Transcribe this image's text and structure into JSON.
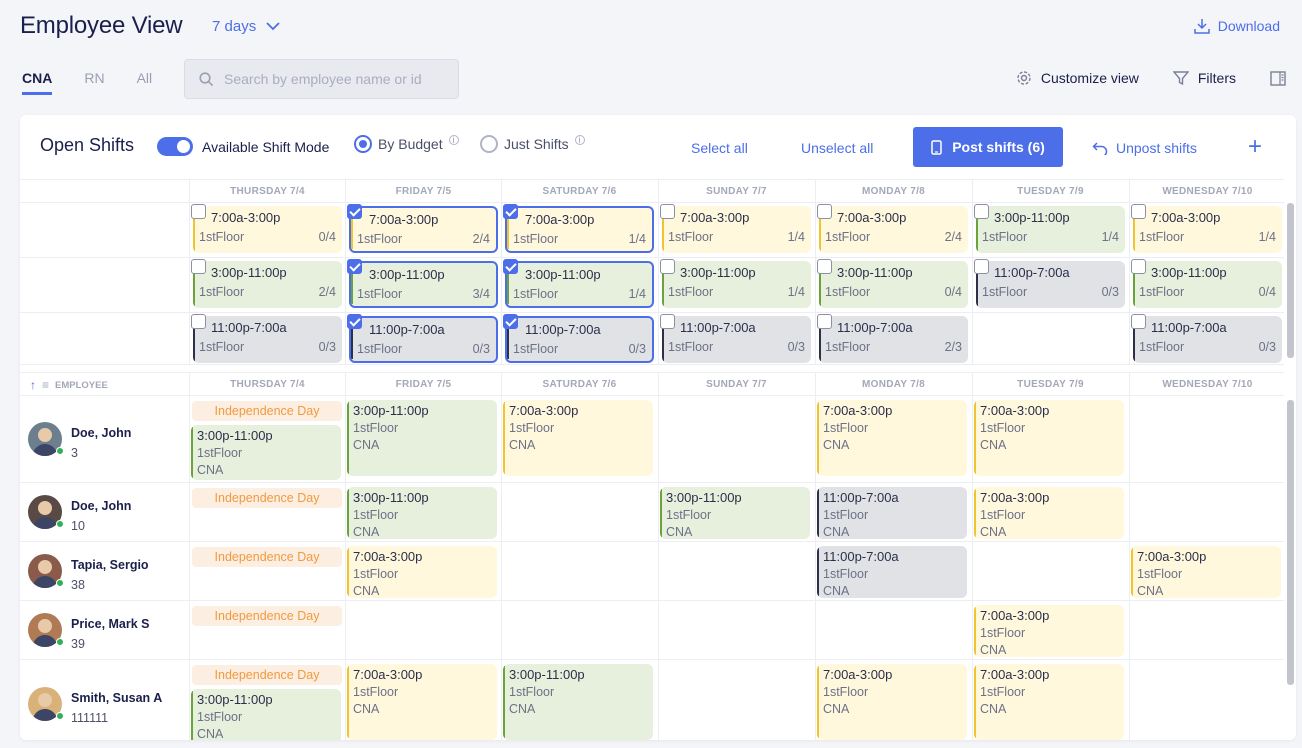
{
  "header": {
    "title": "Employee View",
    "range": "7 days",
    "download": "Download"
  },
  "tabs": [
    "CNA",
    "RN",
    "All"
  ],
  "search": {
    "placeholder": "Search by employee name or id",
    "value": ""
  },
  "tools": {
    "customize": "Customize view",
    "filters": "Filters"
  },
  "controls": {
    "open_shifts": "Open Shifts",
    "available_mode": "Available Shift Mode",
    "by_budget": "By Budget",
    "just_shifts": "Just Shifts",
    "select_all": "Select all",
    "unselect_all": "Unselect all",
    "post": "Post shifts (6)",
    "unpost": "Unpost shifts"
  },
  "days": [
    "THURSDAY 7/4",
    "FRIDAY 7/5",
    "SATURDAY 7/6",
    "SUNDAY 7/7",
    "MONDAY 7/8",
    "TUESDAY 7/9",
    "WEDNESDAY 7/10"
  ],
  "employee_header": "EMPLOYEE",
  "holiday": "Independence Day",
  "open_shifts": [
    [
      {
        "time": "7:00a-3:00p",
        "loc": "1stFloor",
        "count": "0/4",
        "color": "y",
        "checked": false
      },
      {
        "time": "7:00a-3:00p",
        "loc": "1stFloor",
        "count": "2/4",
        "color": "y",
        "checked": true
      },
      {
        "time": "7:00a-3:00p",
        "loc": "1stFloor",
        "count": "1/4",
        "color": "y",
        "checked": true
      },
      {
        "time": "7:00a-3:00p",
        "loc": "1stFloor",
        "count": "1/4",
        "color": "y",
        "checked": false
      },
      {
        "time": "7:00a-3:00p",
        "loc": "1stFloor",
        "count": "2/4",
        "color": "y",
        "checked": false
      },
      {
        "time": "3:00p-11:00p",
        "loc": "1stFloor",
        "count": "1/4",
        "color": "g",
        "checked": false
      },
      {
        "time": "7:00a-3:00p",
        "loc": "1stFloor",
        "count": "1/4",
        "color": "y",
        "checked": false
      }
    ],
    [
      {
        "time": "3:00p-11:00p",
        "loc": "1stFloor",
        "count": "2/4",
        "color": "g",
        "checked": false
      },
      {
        "time": "3:00p-11:00p",
        "loc": "1stFloor",
        "count": "3/4",
        "color": "g",
        "checked": true
      },
      {
        "time": "3:00p-11:00p",
        "loc": "1stFloor",
        "count": "1/4",
        "color": "g",
        "checked": true
      },
      {
        "time": "3:00p-11:00p",
        "loc": "1stFloor",
        "count": "1/4",
        "color": "g",
        "checked": false
      },
      {
        "time": "3:00p-11:00p",
        "loc": "1stFloor",
        "count": "0/4",
        "color": "g",
        "checked": false
      },
      {
        "time": "11:00p-7:00a",
        "loc": "1stFloor",
        "count": "0/3",
        "color": "d",
        "checked": false
      },
      {
        "time": "3:00p-11:00p",
        "loc": "1stFloor",
        "count": "0/4",
        "color": "g",
        "checked": false
      }
    ],
    [
      {
        "time": "11:00p-7:00a",
        "loc": "1stFloor",
        "count": "0/3",
        "color": "d",
        "checked": false
      },
      {
        "time": "11:00p-7:00a",
        "loc": "1stFloor",
        "count": "0/3",
        "color": "d",
        "checked": true
      },
      {
        "time": "11:00p-7:00a",
        "loc": "1stFloor",
        "count": "0/3",
        "color": "d",
        "checked": true
      },
      {
        "time": "11:00p-7:00a",
        "loc": "1stFloor",
        "count": "0/3",
        "color": "d",
        "checked": false
      },
      {
        "time": "11:00p-7:00a",
        "loc": "1stFloor",
        "count": "2/3",
        "color": "d",
        "checked": false
      },
      null,
      {
        "time": "11:00p-7:00a",
        "loc": "1stFloor",
        "count": "0/3",
        "color": "d",
        "checked": false
      }
    ]
  ],
  "employees": [
    {
      "name": "Doe, John",
      "id": "3",
      "holiday": true,
      "shifts": [
        {
          "day": 0,
          "time": "3:00p-11:00p",
          "loc": "1stFloor",
          "role": "CNA",
          "color": "g"
        },
        {
          "day": 1,
          "time": "3:00p-11:00p",
          "loc": "1stFloor",
          "role": "CNA",
          "color": "g"
        },
        {
          "day": 2,
          "time": "7:00a-3:00p",
          "loc": "1stFloor",
          "role": "CNA",
          "color": "y"
        },
        {
          "day": 4,
          "time": "7:00a-3:00p",
          "loc": "1stFloor",
          "role": "CNA",
          "color": "y"
        },
        {
          "day": 5,
          "time": "7:00a-3:00p",
          "loc": "1stFloor",
          "role": "CNA",
          "color": "y"
        }
      ]
    },
    {
      "name": "Doe, John",
      "id": "10",
      "holiday": true,
      "shifts": [
        {
          "day": 1,
          "time": "3:00p-11:00p",
          "loc": "1stFloor",
          "role": "CNA",
          "color": "g"
        },
        {
          "day": 3,
          "time": "3:00p-11:00p",
          "loc": "1stFloor",
          "role": "CNA",
          "color": "g"
        },
        {
          "day": 4,
          "time": "11:00p-7:00a",
          "loc": "1stFloor",
          "role": "CNA",
          "color": "d"
        },
        {
          "day": 5,
          "time": "7:00a-3:00p",
          "loc": "1stFloor",
          "role": "CNA",
          "color": "y"
        }
      ]
    },
    {
      "name": "Tapia, Sergio",
      "id": "38",
      "holiday": true,
      "shifts": [
        {
          "day": 1,
          "time": "7:00a-3:00p",
          "loc": "1stFloor",
          "role": "CNA",
          "color": "y"
        },
        {
          "day": 4,
          "time": "11:00p-7:00a",
          "loc": "1stFloor",
          "role": "CNA",
          "color": "d"
        },
        {
          "day": 6,
          "time": "7:00a-3:00p",
          "loc": "1stFloor",
          "role": "CNA",
          "color": "y"
        }
      ]
    },
    {
      "name": "Price, Mark S",
      "id": "39",
      "holiday": true,
      "shifts": [
        {
          "day": 5,
          "time": "7:00a-3:00p",
          "loc": "1stFloor",
          "role": "CNA",
          "color": "y"
        }
      ]
    },
    {
      "name": "Smith, Susan A",
      "id": "111111",
      "holiday": true,
      "shifts": [
        {
          "day": 0,
          "time": "3:00p-11:00p",
          "loc": "1stFloor",
          "role": "CNA",
          "color": "g"
        },
        {
          "day": 1,
          "time": "7:00a-3:00p",
          "loc": "1stFloor",
          "role": "CNA",
          "color": "y"
        },
        {
          "day": 2,
          "time": "3:00p-11:00p",
          "loc": "1stFloor",
          "role": "CNA",
          "color": "g"
        },
        {
          "day": 4,
          "time": "7:00a-3:00p",
          "loc": "1stFloor",
          "role": "CNA",
          "color": "y"
        },
        {
          "day": 5,
          "time": "7:00a-3:00p",
          "loc": "1stFloor",
          "role": "CNA",
          "color": "y"
        }
      ]
    }
  ],
  "avatar_colors": [
    "#6b7f8f",
    "#5a4a45",
    "#8a5a4a",
    "#b07a55",
    "#d9b27a"
  ]
}
